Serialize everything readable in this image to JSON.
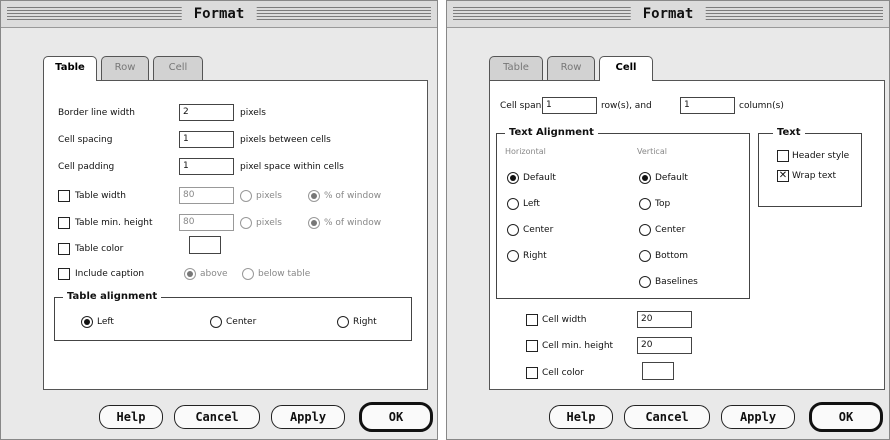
{
  "left_dialog": {
    "title": "Format",
    "tabs": [
      "Table",
      "Row",
      "Cell"
    ],
    "border_line_width": {
      "label": "Border line width",
      "value": "2",
      "unit": "pixels"
    },
    "cell_spacing": {
      "label": "Cell spacing",
      "value": "1",
      "unit": "pixels between cells"
    },
    "cell_padding": {
      "label": "Cell padding",
      "value": "1",
      "unit": "pixel space within cells"
    },
    "table_width": {
      "label": "Table width",
      "value": "80",
      "opt_pixels": "pixels",
      "opt_percent": "% of window"
    },
    "table_min_height": {
      "label": "Table min. height",
      "value": "80",
      "opt_pixels": "pixels",
      "opt_percent": "% of window"
    },
    "table_color": {
      "label": "Table color"
    },
    "include_caption": {
      "label": "Include caption",
      "opt_above": "above",
      "opt_below": "below table"
    },
    "table_alignment": {
      "legend": "Table alignment",
      "left": "Left",
      "center": "Center",
      "right": "Right"
    },
    "buttons": {
      "help": "Help",
      "cancel": "Cancel",
      "apply": "Apply",
      "ok": "OK"
    }
  },
  "right_dialog": {
    "title": "Format",
    "tabs": [
      "Table",
      "Row",
      "Cell"
    ],
    "cell_span": {
      "label": "Cell span",
      "rows_value": "1",
      "rows_label": "row(s), and",
      "cols_value": "1",
      "cols_label": "column(s)"
    },
    "text_alignment": {
      "legend": "Text Alignment",
      "horizontal": "Horizontal",
      "vertical": "Vertical",
      "h_options": [
        "Default",
        "Left",
        "Center",
        "Right"
      ],
      "v_options": [
        "Default",
        "Top",
        "Center",
        "Bottom",
        "Baselines"
      ]
    },
    "text_group": {
      "legend": "Text",
      "header_style": "Header style",
      "wrap_text": "Wrap text"
    },
    "cell_width": {
      "label": "Cell width",
      "value": "20"
    },
    "cell_min_height": {
      "label": "Cell min. height",
      "value": "20"
    },
    "cell_color": {
      "label": "Cell color"
    },
    "buttons": {
      "help": "Help",
      "cancel": "Cancel",
      "apply": "Apply",
      "ok": "OK"
    }
  }
}
